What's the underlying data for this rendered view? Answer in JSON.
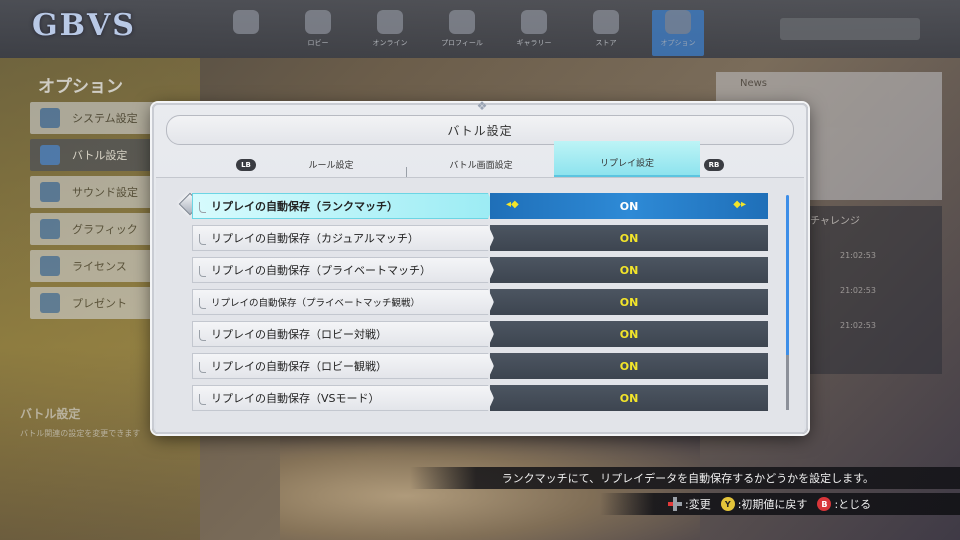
{
  "background": {
    "logo": "GBVS",
    "nav": [
      "",
      "ロビー",
      "オンライン",
      "プロフィール",
      "ギャラリー",
      "ストア",
      "オプション"
    ],
    "options_title": "オプション",
    "menu": [
      "システム設定",
      "バトル設定",
      "サウンド設定",
      "グラフィック",
      "ライセンス",
      "プレゼント"
    ],
    "desc_title": "バトル設定",
    "desc_text": "バトル関連の設定を変更できます",
    "news_label": "News",
    "challenge_label": "チャレンジ",
    "times": [
      "21:02:53",
      "21:02:53",
      "21:02:53"
    ]
  },
  "modal": {
    "title": "バトル設定",
    "tab_prev_button": "LB",
    "tab_next_button": "RB",
    "tabs": [
      {
        "label": "ルール設定"
      },
      {
        "label": "バトル画面設定"
      },
      {
        "label": "リプレイ設定"
      }
    ],
    "active_tab": 2,
    "rows": [
      {
        "label": "リプレイの自動保存（ランクマッチ）",
        "value": "ON"
      },
      {
        "label": "リプレイの自動保存（カジュアルマッチ）",
        "value": "ON"
      },
      {
        "label": "リプレイの自動保存（プライベートマッチ）",
        "value": "ON"
      },
      {
        "label": "リプレイの自動保存（プライベートマッチ観戦）",
        "value": "ON"
      },
      {
        "label": "リプレイの自動保存（ロビー対戦）",
        "value": "ON"
      },
      {
        "label": "リプレイの自動保存（ロビー観戦）",
        "value": "ON"
      },
      {
        "label": "リプレイの自動保存（VSモード）",
        "value": "ON"
      }
    ],
    "selected_row": 0
  },
  "description": "ランクマッチにて、リプレイデータを自動保存するかどうかを設定します。",
  "help": {
    "change": ":変更",
    "reset_button": "Y",
    "reset": ":初期値に戻す",
    "close_button": "B",
    "close": ":とじる"
  },
  "colors": {
    "accent_cyan": "#9cecf4",
    "value_yellow": "#f3e52a",
    "selected_blue": "#2e8ad6"
  }
}
